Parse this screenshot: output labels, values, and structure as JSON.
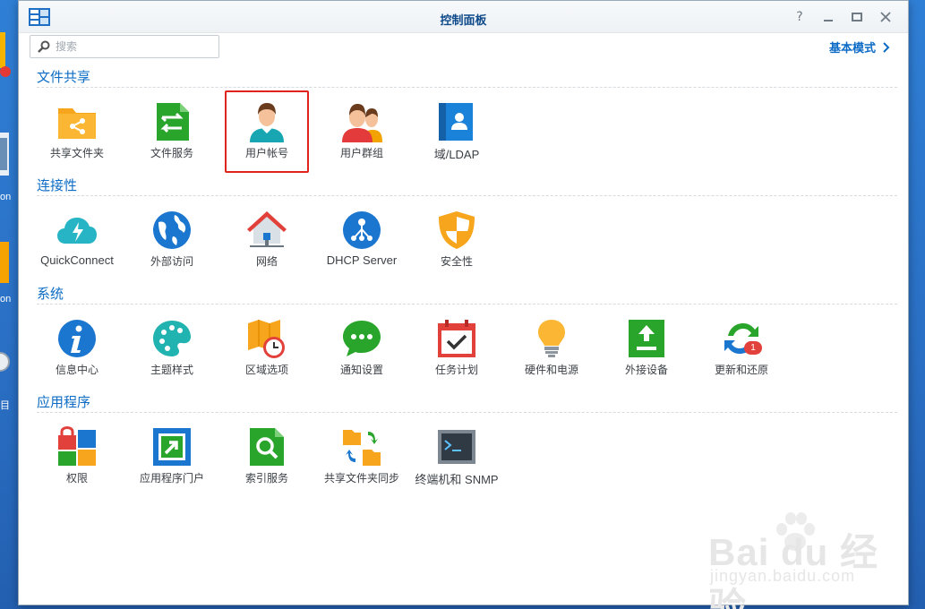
{
  "window": {
    "title": "控制面板"
  },
  "search": {
    "placeholder": "搜索"
  },
  "header": {
    "mode_link": "基本模式"
  },
  "sections": [
    {
      "title": "文件共享",
      "items": [
        {
          "label": "共享文件夹",
          "icon": "shared-folder-icon"
        },
        {
          "label": "文件服务",
          "icon": "file-services-icon"
        },
        {
          "label": "用户帐号",
          "icon": "user-account-icon",
          "highlighted": true
        },
        {
          "label": "用户群组",
          "icon": "user-group-icon"
        },
        {
          "label": "域/LDAP",
          "icon": "domain-ldap-icon"
        }
      ]
    },
    {
      "title": "连接性",
      "items": [
        {
          "label": "QuickConnect",
          "icon": "quickconnect-icon"
        },
        {
          "label": "外部访问",
          "icon": "external-access-icon"
        },
        {
          "label": "网络",
          "icon": "network-icon"
        },
        {
          "label": "DHCP Server",
          "icon": "dhcp-server-icon"
        },
        {
          "label": "安全性",
          "icon": "security-icon"
        }
      ]
    },
    {
      "title": "系统",
      "items": [
        {
          "label": "信息中心",
          "icon": "info-center-icon"
        },
        {
          "label": "主题样式",
          "icon": "theme-icon"
        },
        {
          "label": "区域选项",
          "icon": "regional-options-icon"
        },
        {
          "label": "通知设置",
          "icon": "notification-icon"
        },
        {
          "label": "任务计划",
          "icon": "task-scheduler-icon"
        },
        {
          "label": "硬件和电源",
          "icon": "hardware-power-icon"
        },
        {
          "label": "外接设备",
          "icon": "external-devices-icon"
        },
        {
          "label": "更新和还原",
          "icon": "update-restore-icon",
          "badge": "1"
        }
      ]
    },
    {
      "title": "应用程序",
      "items": [
        {
          "label": "权限",
          "icon": "privileges-icon"
        },
        {
          "label": "应用程序门户",
          "icon": "application-portal-icon"
        },
        {
          "label": "索引服务",
          "icon": "indexing-service-icon"
        },
        {
          "label": "共享文件夹同步",
          "icon": "shared-folder-sync-icon"
        },
        {
          "label": "终端机和 SNMP",
          "icon": "terminal-snmp-icon"
        }
      ]
    }
  ],
  "desktop": {
    "label_a": "on",
    "label_b": "目"
  },
  "watermark": {
    "brand": "Bai du 经验",
    "url": "jingyan.baidu.com"
  }
}
